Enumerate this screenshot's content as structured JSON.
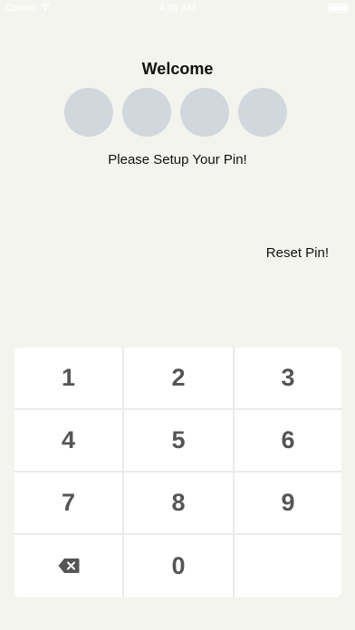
{
  "status_bar": {
    "carrier": "Carrier",
    "time": "4:01 AM",
    "icons": [
      "wifi-icon",
      "battery-icon"
    ]
  },
  "header": {
    "title": "Welcome",
    "pin_dot_count": 4,
    "pin_dot_color": "#d0d8de",
    "instruction": "Please Setup Your Pin!"
  },
  "actions": {
    "reset_label": "Reset Pin!"
  },
  "keypad": {
    "keys": [
      "1",
      "2",
      "3",
      "4",
      "5",
      "6",
      "7",
      "8",
      "9",
      "",
      "0",
      ""
    ],
    "backspace_icon": "backspace-icon"
  },
  "colors": {
    "background": "#f4f4ef",
    "key_text": "#555555",
    "key_background": "#ffffff"
  }
}
